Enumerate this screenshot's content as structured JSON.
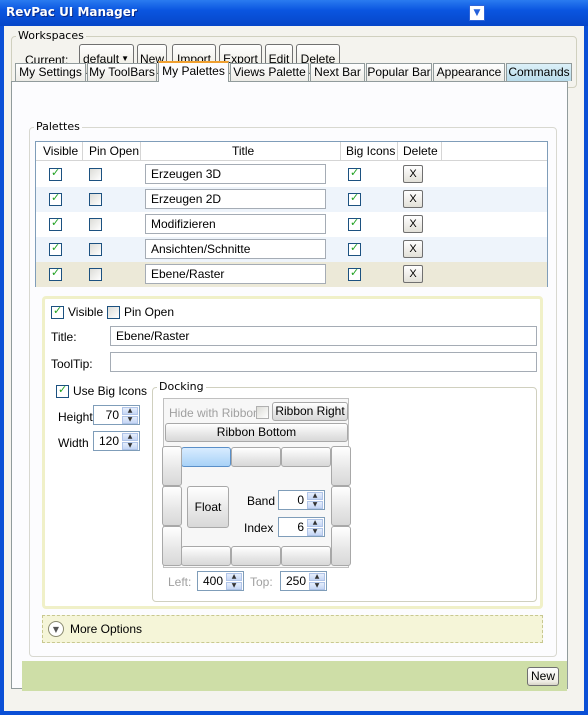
{
  "window": {
    "title": "RevPac UI Manager",
    "title_dropdown_icon": "▼",
    "min": "_",
    "max": "□",
    "close": "✕"
  },
  "workspaces": {
    "group_label": "Workspaces",
    "current_label": "Current:",
    "current_value": "default",
    "buttons": {
      "new": "New",
      "import": "Import",
      "export": "Export",
      "edit": "Edit",
      "delete": "Delete"
    }
  },
  "tabs": [
    "My Settings",
    "My ToolBars",
    "My Palettes",
    "Views Palette",
    "Next Bar",
    "Popular Bar",
    "Appearance",
    "Commands"
  ],
  "active_tab": "My Palettes",
  "palettes": {
    "group_label": "Palettes",
    "columns": {
      "visible": "Visible",
      "pin_open": "Pin Open",
      "title": "Title",
      "big_icons": "Big Icons",
      "delete": "Delete"
    },
    "rows": [
      {
        "visible": true,
        "pin_open": false,
        "title": "Erzeugen 3D",
        "big_icons": true,
        "delete": "X"
      },
      {
        "visible": true,
        "pin_open": false,
        "title": "Erzeugen 2D",
        "big_icons": true,
        "delete": "X"
      },
      {
        "visible": true,
        "pin_open": false,
        "title": "Modifizieren",
        "big_icons": true,
        "delete": "X"
      },
      {
        "visible": true,
        "pin_open": false,
        "title": "Ansichten/Schnitte",
        "big_icons": true,
        "delete": "X"
      },
      {
        "visible": true,
        "pin_open": false,
        "title": "Ebene/Raster",
        "big_icons": true,
        "delete": "X"
      }
    ]
  },
  "detail": {
    "visible_label": "Visible",
    "pin_open_label": "Pin Open",
    "title_label": "Title:",
    "title_value": "Ebene/Raster",
    "tooltip_label": "ToolTip:",
    "tooltip_value": "",
    "use_big_icons_label": "Use Big Icons",
    "height_label": "Height",
    "height_value": "70",
    "width_label": "Width",
    "width_value": "120",
    "docking": {
      "group_label": "Docking",
      "hide_with_ribbon": "Hide with Ribbon",
      "ribbon_right": "Ribbon Right",
      "ribbon_bottom": "Ribbon Bottom",
      "float": "Float",
      "band_label": "Band",
      "band_value": "0",
      "index_label": "Index",
      "index_value": "6",
      "left_label": "Left:",
      "left_value": "400",
      "top_label": "Top:",
      "top_value": "250"
    },
    "more_options": "More Options"
  },
  "footer": {
    "new": "New"
  }
}
